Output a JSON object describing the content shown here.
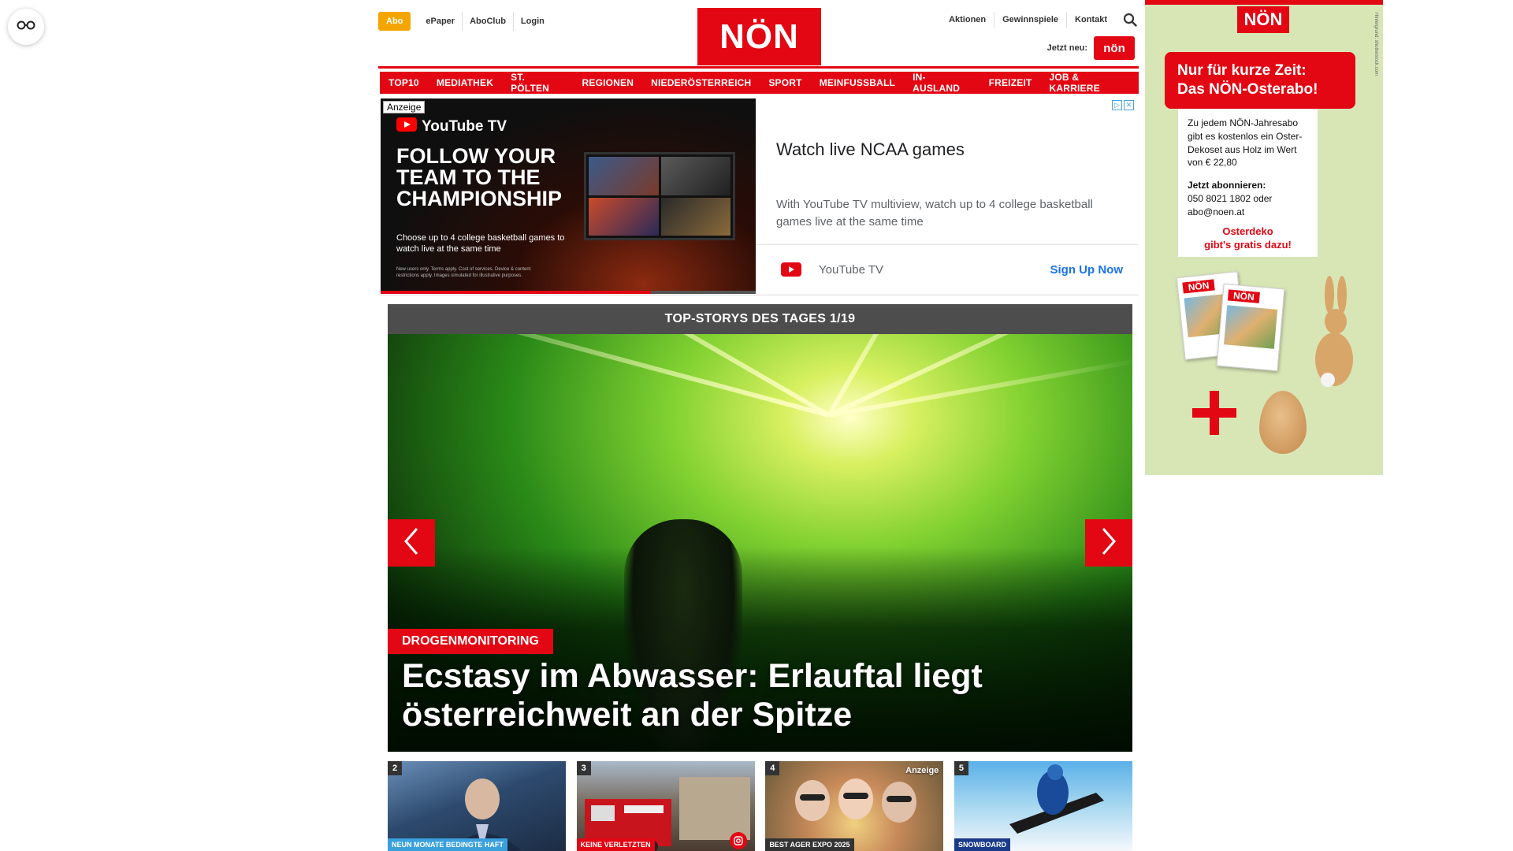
{
  "header": {
    "abo_label": "Abo",
    "links_left": [
      "ePaper",
      "AboClub",
      "Login"
    ],
    "logo_text": "NÖN",
    "links_right": [
      "Aktionen",
      "Gewinnspiele",
      "Kontakt"
    ],
    "jetzt_neu_label": "Jetzt neu:",
    "jetzt_neu_badge": "nön",
    "accent_color": "#e30613",
    "abo_color": "#f5a500"
  },
  "nav": {
    "items": [
      "TOP10",
      "MEDIATHEK",
      "ST. PÖLTEN",
      "REGIONEN",
      "NIEDERÖSTERREICH",
      "SPORT",
      "MEINFUSSBALL",
      "IN-AUSLAND",
      "FREIZEIT",
      "JOB & KARRIERE"
    ]
  },
  "ad": {
    "tag": "Anzeige",
    "brand": "YouTube TV",
    "headline": "FOLLOW YOUR TEAM TO THE CHAMPIONSHIP",
    "sub": "Choose up to 4 college basketball games to watch live at the same time",
    "fine_print": "New users only. Terms apply. Cost of services. Device & content restrictions apply. Images simulated for illustrative purposes.",
    "title": "Watch live NCAA games",
    "description": "With YouTube TV multiview, watch up to 4 college basketball games live at the same time",
    "advertiser": "YouTube TV",
    "cta": "Sign Up Now",
    "progress": 0.72
  },
  "top_stories": {
    "bar_title": "TOP-STORYS DES TAGES 1/19",
    "kicker": "DROGENMONITORING",
    "headline": "Ecstasy im Abwasser: Erlauftal liegt österreichweit an der Spitze"
  },
  "thumbnails": [
    {
      "num": "2",
      "tag": "NEUN MONATE BEDINGTE HAFT",
      "tag_color": "#3aa0dc"
    },
    {
      "num": "3",
      "tag": "KEINE VERLETZTEN",
      "tag_color": "#e30613"
    },
    {
      "num": "4",
      "tag": "BEST AGER EXPO 2025",
      "tag_color": "#333333",
      "anzeige": "Anzeige"
    },
    {
      "num": "5",
      "tag": "SNOWBOARD",
      "tag_color": "#1a3a8a"
    }
  ],
  "sky": {
    "logo": "NÖN",
    "credit": "Hintergrund: shutterstock.com",
    "banner_line1": "Nur für kurze Zeit:",
    "banner_line2": "Das NÖN-Osterabo!",
    "note": "Zu jedem NÖN-Jahresabo gibt es kostenlos ein Oster-Dekoset aus Holz im Wert von € 22,80",
    "note_bold": "Jetzt abonnieren:",
    "contact": "050 8021 1802 oder abo@noen.at",
    "deko_line1": "Osterdeko",
    "deko_line2": "gibt's gratis dazu!",
    "mag_logo": "NÖN"
  }
}
